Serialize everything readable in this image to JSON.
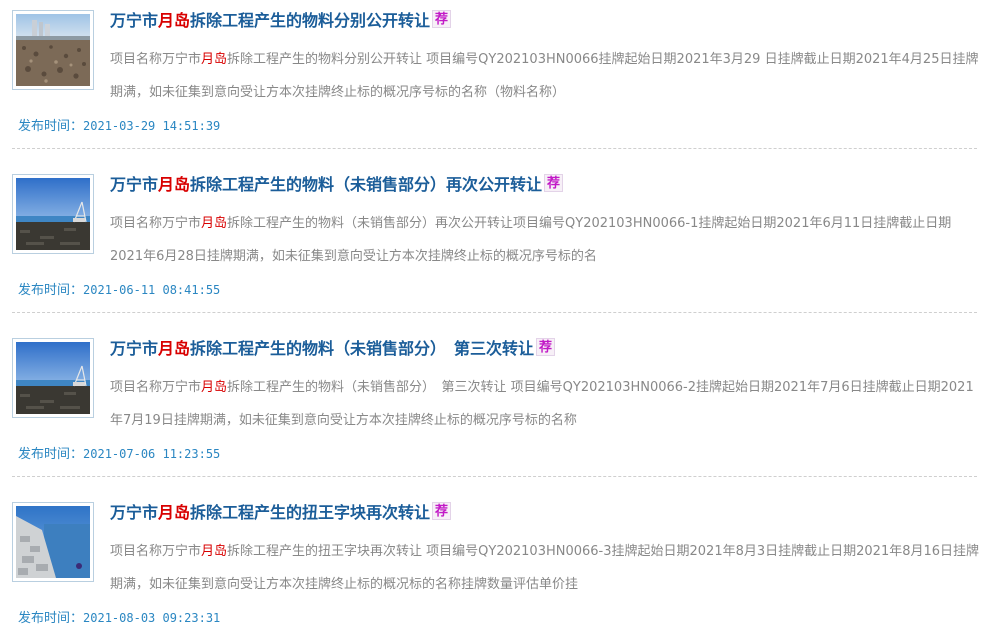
{
  "items": [
    {
      "title_pre": "万宁市",
      "title_hl": "月岛",
      "title_post": "拆除工程产生的物料分别公开转让",
      "badge": "荐",
      "desc_pre": "项目名称万宁市",
      "desc_hl": "月岛",
      "desc_post": "拆除工程产生的物料分别公开转让 项目编号QY202103HN0066挂牌起始日期2021年3月29 日挂牌截止日期2021年4月25日挂牌期满，如未征集到意向受让方本次挂牌终止标的概况序号标的名称（物料名称）",
      "date_label": "发布时间：",
      "date": "2021-03-29 14:51:39",
      "thumb_kind": "beach-rocks"
    },
    {
      "title_pre": "万宁市",
      "title_hl": "月岛",
      "title_post": "拆除工程产生的物料（未销售部分）再次公开转让",
      "badge": "荐",
      "desc_pre": "项目名称万宁市",
      "desc_hl": "月岛",
      "desc_post": "拆除工程产生的物料（未销售部分）再次公开转让项目编号QY202103HN0066-1挂牌起始日期2021年6月11日挂牌截止日期2021年6月28日挂牌期满，如未征集到意向受让方本次挂牌终止标的概况序号标的名",
      "date_label": "发布时间：",
      "date": "2021-06-11 08:41:55",
      "thumb_kind": "sea-crane"
    },
    {
      "title_pre": "万宁市",
      "title_hl": "月岛",
      "title_post": "拆除工程产生的物料（未销售部分）　第三次转让",
      "badge": "荐",
      "desc_pre": "项目名称万宁市",
      "desc_hl": "月岛",
      "desc_post": "拆除工程产生的物料（未销售部分）　第三次转让 项目编号QY202103HN0066-2挂牌起始日期2021年7月6日挂牌截止日期2021年7月19日挂牌期满，如未征集到意向受让方本次挂牌终止标的概况序号标的名称",
      "date_label": "发布时间：",
      "date": "2021-07-06 11:23:55",
      "thumb_kind": "sea-crane"
    },
    {
      "title_pre": "万宁市",
      "title_hl": "月岛",
      "title_post": "拆除工程产生的扭王字块再次转让",
      "badge": "荐",
      "desc_pre": "项目名称万宁市",
      "desc_hl": "月岛",
      "desc_post": "拆除工程产生的扭王字块再次转让 项目编号QY202103HN0066-3挂牌起始日期2021年8月3日挂牌截止日期2021年8月16日挂牌期满，如未征集到意向受让方本次挂牌终止标的概况标的名称挂牌数量评估单价挂",
      "date_label": "发布时间：",
      "date": "2021-08-03 09:23:31",
      "thumb_kind": "breakwater"
    }
  ]
}
